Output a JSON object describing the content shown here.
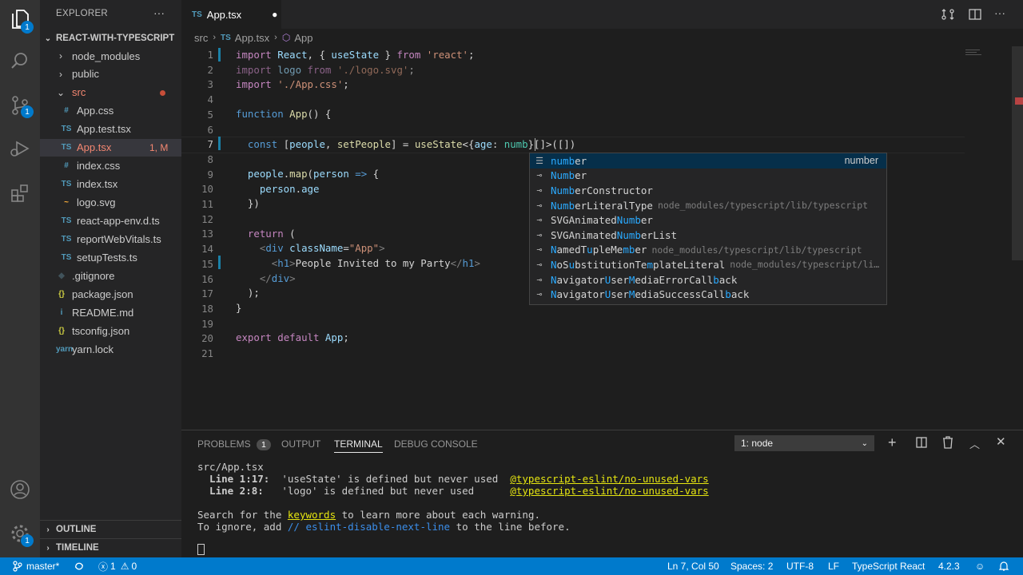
{
  "colors": {
    "accent": "#007acc",
    "statusbar": "#007acc",
    "activitybar": "#333333",
    "sidebar": "#252526",
    "editor": "#1e1e1e"
  },
  "activity": {
    "explorer_badge": "1",
    "scm_badge": "1",
    "settings_badge": "1"
  },
  "explorer": {
    "title": "EXPLORER",
    "more": "···",
    "project": "REACT-WITH-TYPESCRIPT",
    "items": [
      {
        "name": "node_modules",
        "type": "folder",
        "icon": "chevron-right",
        "indent": 1
      },
      {
        "name": "public",
        "type": "folder",
        "icon": "chevron-right",
        "indent": 1
      },
      {
        "name": "src",
        "type": "folder-open",
        "icon": "chevron-down",
        "indent": 1
      },
      {
        "name": "App.css",
        "type": "css",
        "icon": "#",
        "indent": 2
      },
      {
        "name": "App.test.tsx",
        "type": "tsx",
        "icon": "TS",
        "indent": 2
      },
      {
        "name": "App.tsx",
        "type": "tsx",
        "icon": "TS",
        "indent": 2,
        "status": "1, M"
      },
      {
        "name": "index.css",
        "type": "css",
        "icon": "#",
        "indent": 2
      },
      {
        "name": "index.tsx",
        "type": "tsx",
        "icon": "TS",
        "indent": 2
      },
      {
        "name": "logo.svg",
        "type": "svg",
        "icon": "~",
        "indent": 2
      },
      {
        "name": "react-app-env.d.ts",
        "type": "ts",
        "icon": "TS",
        "indent": 2
      },
      {
        "name": "reportWebVitals.ts",
        "type": "ts",
        "icon": "TS",
        "indent": 2
      },
      {
        "name": "setupTests.ts",
        "type": "ts",
        "icon": "TS",
        "indent": 2
      },
      {
        "name": ".gitignore",
        "type": "git",
        "icon": "◆",
        "indent": 1
      },
      {
        "name": "package.json",
        "type": "json",
        "icon": "{}",
        "indent": 1
      },
      {
        "name": "README.md",
        "type": "md",
        "icon": "i",
        "indent": 1
      },
      {
        "name": "tsconfig.json",
        "type": "json",
        "icon": "{}",
        "indent": 1
      },
      {
        "name": "yarn.lock",
        "type": "lock",
        "icon": "yarn",
        "indent": 1
      }
    ],
    "outline": "OUTLINE",
    "timeline": "TIMELINE"
  },
  "editor": {
    "tab_icon": "TS",
    "tab_label": "App.tsx",
    "breadcrumb": {
      "folder": "src",
      "file_icon": "TS",
      "file": "App.tsx",
      "symbol": "App"
    },
    "line_numbers": [
      "1",
      "2",
      "3",
      "4",
      "5",
      "6",
      "7",
      "8",
      "9",
      "10",
      "11",
      "12",
      "13",
      "14",
      "15",
      "16",
      "17",
      "18",
      "19",
      "20",
      "21"
    ],
    "current_line": "7"
  },
  "suggest": {
    "items": [
      {
        "icon": "keyword",
        "pre": "",
        "m": "numb",
        "post": "er",
        "detail": "number",
        "right": true
      },
      {
        "icon": "interface",
        "pre": "",
        "m": "Numb",
        "post": "er",
        "detail": ""
      },
      {
        "icon": "interface",
        "pre": "",
        "m": "Numb",
        "post": "erConstructor",
        "detail": ""
      },
      {
        "icon": "interface",
        "pre": "",
        "m": "Numb",
        "post": "erLiteralType",
        "detail": "node_modules/typescript/lib/typescript"
      },
      {
        "icon": "interface",
        "pre": "SVGAnimated",
        "m": "Numb",
        "post": "er",
        "detail": ""
      },
      {
        "icon": "interface",
        "pre": "SVGAnimated",
        "m": "Numb",
        "post": "erList",
        "detail": ""
      },
      {
        "icon": "interface",
        "pre": "",
        "m": "N",
        "post": "amedT",
        "m2": "u",
        "post2": "pleMe",
        "m3": "mb",
        "post3": "er",
        "detail": "node_modules/typescript/lib/typescript"
      },
      {
        "icon": "interface",
        "pre": "",
        "m": "N",
        "post": "oS",
        "m2": "u",
        "post2": "bstitutionTe",
        "m3": "m",
        "post3": "plateLiteral",
        "detail": "node_modules/typescript/li…"
      },
      {
        "icon": "interface",
        "pre": "",
        "m": "N",
        "post": "avigator",
        "m2": "U",
        "post2": "ser",
        "m3": "M",
        "post3": "ediaErrorCall",
        "m4": "b",
        "post4": "ack",
        "detail": ""
      },
      {
        "icon": "interface",
        "pre": "",
        "m": "N",
        "post": "avigator",
        "m2": "U",
        "post2": "ser",
        "m3": "M",
        "post3": "ediaSuccessCall",
        "m4": "b",
        "post4": "ack",
        "detail": ""
      }
    ]
  },
  "panel": {
    "tabs": {
      "problems": "PROBLEMS",
      "problems_count": "1",
      "output": "OUTPUT",
      "terminal": "TERMINAL",
      "debug": "DEBUG CONSOLE"
    },
    "terminal_select": "1: node",
    "lines": {
      "file": "src/App.tsx",
      "l1_loc": "  Line 1:17:",
      "l1_msg": "  'useState' is defined but never used  ",
      "l1_rule": "@typescript-eslint/no-unused-vars",
      "l2_loc": "  Line 2:8:",
      "l2_msg": "   'logo' is defined but never used      ",
      "l2_rule": "@typescript-eslint/no-unused-vars",
      "s1": "Search for the ",
      "s1k": "keywords",
      "s1e": " to learn more about each warning.",
      "s2": "To ignore, add ",
      "s2k": "// eslint-disable-next-line",
      "s2e": " to the line before."
    }
  },
  "status": {
    "branch": "master*",
    "errors": "1",
    "warnings": "0",
    "cursor": "Ln 7, Col 50",
    "spaces": "Spaces: 2",
    "encoding": "UTF-8",
    "eol": "LF",
    "language": "TypeScript React",
    "version": "4.2.3"
  }
}
